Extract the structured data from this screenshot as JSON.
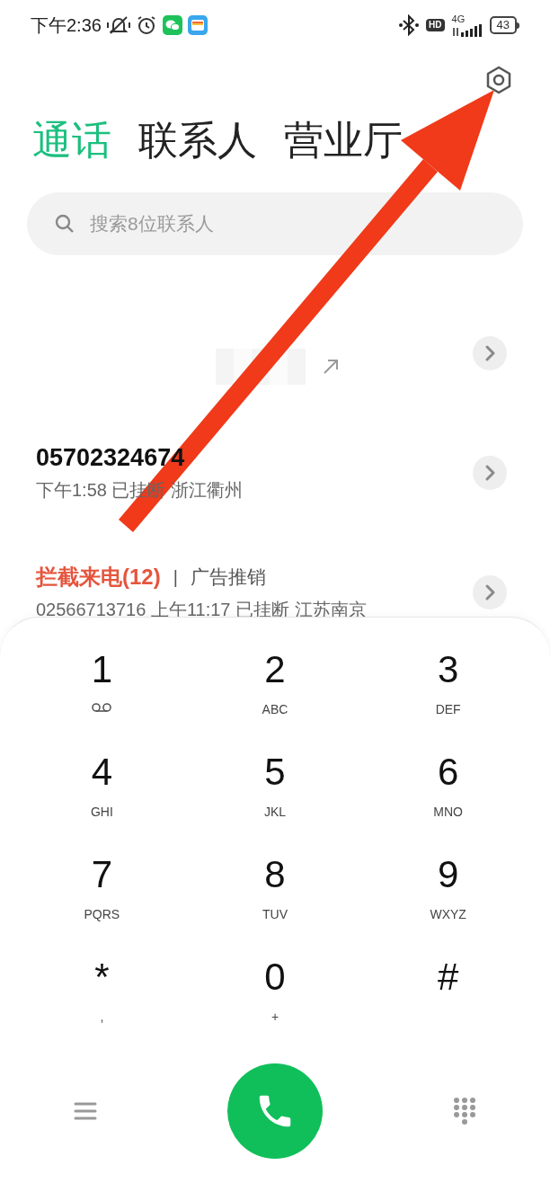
{
  "status_bar": {
    "time": "下午2:36",
    "hd": "HD",
    "network": "4G",
    "battery": "43"
  },
  "tabs": [
    {
      "label": "通话",
      "selected": true
    },
    {
      "label": "联系人",
      "selected": false
    },
    {
      "label": "营业厅",
      "selected": false
    }
  ],
  "search": {
    "placeholder": "搜索8位联系人"
  },
  "calls": [
    {
      "kind": "redacted"
    },
    {
      "kind": "call",
      "number": "05702324674",
      "detail": "下午1:58 已挂断 浙江衢州"
    },
    {
      "kind": "blocked",
      "title": "拦截来电(12)",
      "separator": "|",
      "category": "广告推销",
      "detail": "02566713716 上午11:17 已挂断 江苏南京"
    }
  ],
  "keypad": [
    {
      "digit": "1",
      "kind": "voicemail"
    },
    {
      "digit": "2",
      "kind": "letters",
      "letters": "ABC"
    },
    {
      "digit": "3",
      "kind": "letters",
      "letters": "DEF"
    },
    {
      "digit": "4",
      "kind": "letters",
      "letters": "GHI"
    },
    {
      "digit": "5",
      "kind": "letters",
      "letters": "JKL"
    },
    {
      "digit": "6",
      "kind": "letters",
      "letters": "MNO"
    },
    {
      "digit": "7",
      "kind": "letters",
      "letters": "PQRS"
    },
    {
      "digit": "8",
      "kind": "letters",
      "letters": "TUV"
    },
    {
      "digit": "9",
      "kind": "letters",
      "letters": "WXYZ"
    },
    {
      "digit": "*",
      "kind": "letters",
      "letters": ","
    },
    {
      "digit": "0",
      "kind": "letters",
      "letters": "+"
    },
    {
      "digit": "#",
      "kind": "plain"
    }
  ]
}
